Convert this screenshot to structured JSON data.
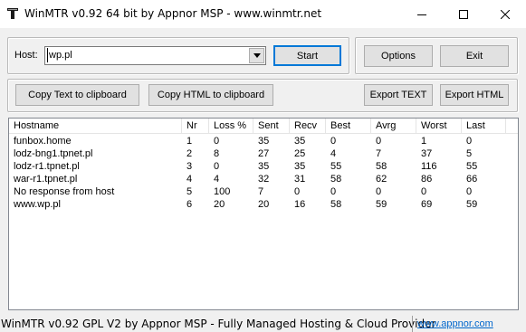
{
  "window": {
    "title": "WinMTR v0.92 64 bit by Appnor MSP - www.winmtr.net",
    "icon": "winmtr-app-icon",
    "controls": [
      "minimize-icon",
      "maximize-icon",
      "close-icon"
    ]
  },
  "host": {
    "label": "Host:",
    "value": "wp.pl"
  },
  "buttons": {
    "start": "Start",
    "options": "Options",
    "exit": "Exit",
    "copy_text": "Copy Text to clipboard",
    "copy_html": "Copy HTML to clipboard",
    "export_text": "Export TEXT",
    "export_html": "Export HTML"
  },
  "table": {
    "columns": [
      "Hostname",
      "Nr",
      "Loss %",
      "Sent",
      "Recv",
      "Best",
      "Avrg",
      "Worst",
      "Last"
    ],
    "rows": [
      [
        "funbox.home",
        "1",
        "0",
        "35",
        "35",
        "0",
        "0",
        "1",
        "0"
      ],
      [
        "lodz-bng1.tpnet.pl",
        "2",
        "8",
        "27",
        "25",
        "4",
        "7",
        "37",
        "5"
      ],
      [
        "lodz-r1.tpnet.pl",
        "3",
        "0",
        "35",
        "35",
        "55",
        "58",
        "116",
        "55"
      ],
      [
        "war-r1.tpnet.pl",
        "4",
        "4",
        "32",
        "31",
        "58",
        "62",
        "86",
        "66"
      ],
      [
        "No response from host",
        "5",
        "100",
        "7",
        "0",
        "0",
        "0",
        "0",
        "0"
      ],
      [
        "www.wp.pl",
        "6",
        "20",
        "20",
        "16",
        "58",
        "59",
        "69",
        "59"
      ]
    ]
  },
  "status": {
    "text": "WinMTR v0.92 GPL V2 by Appnor MSP - Fully Managed Hosting & Cloud Provider",
    "link": "www.appnor.com"
  },
  "colors": {
    "accent": "#0078d7",
    "link": "#0066cc",
    "background": "#f0f0f0"
  }
}
